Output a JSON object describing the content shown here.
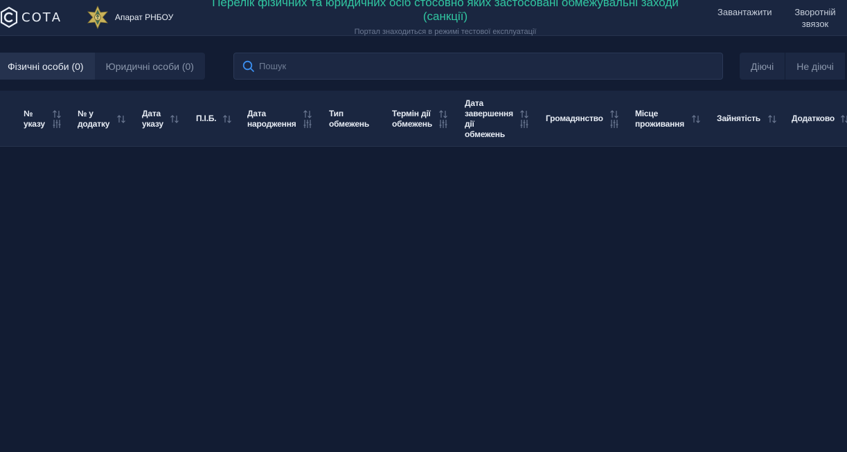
{
  "header": {
    "logo_text": "СОТА",
    "org_label": "Апарат РНБОУ",
    "title_line1": "Перелік фізичних та юридичних осіб стосовно яких застосовані обмежувальні заходи",
    "title_line2": "(санкції)",
    "subtitle": "Портал знаходиться в режимі тестової експлуатації",
    "download_label": "Завантажити",
    "feedback_line1": "Зворотній",
    "feedback_line2": "звязок",
    "accent_color": "#31c6a1"
  },
  "tabs": [
    {
      "label": "Фізичні особи (0)",
      "active": true
    },
    {
      "label": "Юридичні особи (0)",
      "active": false
    }
  ],
  "search": {
    "placeholder": "Пошук"
  },
  "status_filters": [
    {
      "label": "Діючі"
    },
    {
      "label": "Не діючі"
    }
  ],
  "table": {
    "columns": [
      {
        "lines": [
          "№",
          "указу"
        ],
        "filter": true
      },
      {
        "lines": [
          "№ у",
          "додатку"
        ],
        "filter": false
      },
      {
        "lines": [
          "Дата",
          "указу"
        ],
        "filter": false
      },
      {
        "lines": [
          "П.І.Б."
        ],
        "filter": false
      },
      {
        "lines": [
          "Дата",
          "народження"
        ],
        "filter": true
      },
      {
        "lines": [
          "Тип",
          "обмежень"
        ],
        "filter": false
      },
      {
        "lines": [
          "Термін дії",
          "обмежень"
        ],
        "filter": true
      },
      {
        "lines": [
          "Дата",
          "завершення",
          "дії",
          "обмежень"
        ],
        "filter": true
      },
      {
        "lines": [
          "Громадянство"
        ],
        "filter": true
      },
      {
        "lines": [
          "Місце",
          "проживання"
        ],
        "filter": false
      },
      {
        "lines": [
          "Зайнятість"
        ],
        "filter": false
      },
      {
        "lines": [
          "Додатково"
        ],
        "filter": false
      }
    ],
    "rows": []
  }
}
